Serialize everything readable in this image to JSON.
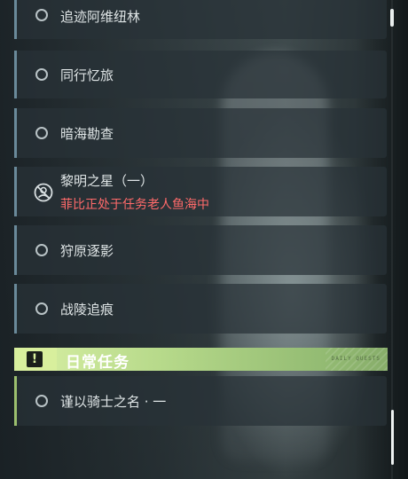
{
  "quests": [
    {
      "name": "追迹阿维纽林",
      "status": ""
    },
    {
      "name": "同行忆旅",
      "status": ""
    },
    {
      "name": "暗海勘查",
      "status": ""
    },
    {
      "name": "黎明之星（一）",
      "status": "菲比正处于任务老人鱼海中"
    },
    {
      "name": "狩原逐影",
      "status": ""
    },
    {
      "name": "战陵追痕",
      "status": ""
    }
  ],
  "daily_section": {
    "title": "日常任务",
    "icon": "!",
    "decoration": "DAILY QUESTS"
  },
  "daily_quests": [
    {
      "name": "谨以骑士之名 · 一"
    }
  ],
  "colors": {
    "accent_green": "#d8ef9d",
    "alert_red": "#ff6a6a",
    "quest_bar": "#6a8a9a",
    "daily_bar": "#9cbf6e"
  }
}
